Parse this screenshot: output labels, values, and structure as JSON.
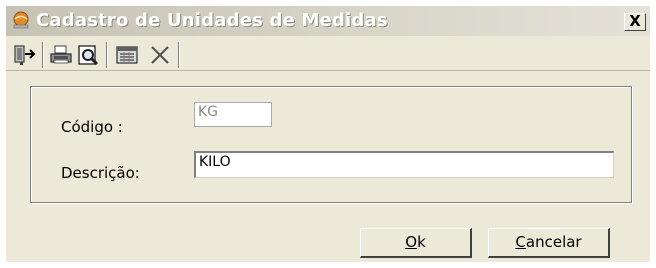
{
  "window": {
    "title": "Cadastro de Unidades de Medidas",
    "close_label": "X",
    "title_icon": "app-globe-icon"
  },
  "toolbar": {
    "buttons": [
      {
        "icon": "exit-door-icon",
        "label": ""
      },
      {
        "icon": "print-icon",
        "label": ""
      },
      {
        "icon": "print-preview-icon",
        "label": ""
      },
      {
        "icon": "list-icon",
        "label": ""
      },
      {
        "icon": "delete-x-icon",
        "label": ""
      }
    ]
  },
  "form": {
    "codigo_label": "Código :",
    "codigo_value": "KG",
    "descricao_label": "Descrição:",
    "descricao_value": "KILO"
  },
  "buttons": {
    "ok_mnemonic": "O",
    "ok_rest": "k",
    "cancel_mnemonic": "C",
    "cancel_rest": "ancelar"
  },
  "colors": {
    "window_bg": "#ece9d8",
    "title_gradient_start": "#c6c3b5",
    "title_text": "#ffffff",
    "field_border": "#7f9db9"
  }
}
